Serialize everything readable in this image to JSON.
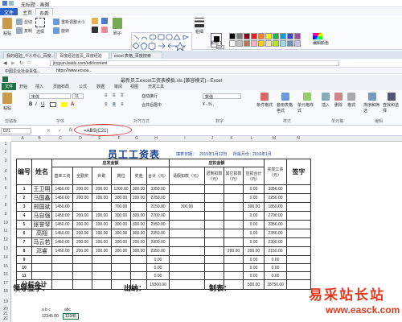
{
  "paint": {
    "title": "无标题 - 画图",
    "tabs": [
      "文件",
      "主页",
      "查看"
    ],
    "color_label": "颜色 1",
    "color2_label": "颜色 2",
    "edit_colors": "编辑颜色",
    "tools": [
      "粘贴",
      "剪切",
      "复制",
      "选择",
      "重新调整大小",
      "旋转",
      "刷子",
      "粗细"
    ],
    "swatch_colors": [
      "#000000",
      "#7f7f7f",
      "#880015",
      "#ed1c24",
      "#ff7f27",
      "#fff200",
      "#22b14c",
      "#00a2e8",
      "#3f48cc",
      "#a349a4",
      "#ffffff",
      "#c3c3c3",
      "#b97a57",
      "#ffaec9",
      "#ffc90e",
      "#efe4b0",
      "#b5e61d",
      "#99d9ea",
      "#7092be",
      "#c8bfe7"
    ]
  },
  "browser": {
    "tabs": [
      "我的经验_个人中心_百度...",
      "百度经验首页_百度经验",
      "excel 表格_百度搜索"
    ],
    "url": "jingyan.baidu.com/edit/content",
    "favorites": [
      "中国企业社会责任...",
      "https://www.ecsoa..."
    ]
  },
  "excel": {
    "title": "最新员工excel工资表模板.xls [兼容模式] - Excel",
    "tabs": [
      "文件",
      "开始",
      "插入",
      "页面布局",
      "公式",
      "数据",
      "审阅",
      "视图",
      "开发工具"
    ],
    "font_name": "宋体",
    "font_size": "11",
    "number_format": "数值",
    "wrap_text": "自动换行",
    "merge": "合并后居中",
    "groups": [
      "剪贴板",
      "字体",
      "对齐方式",
      "数字",
      "样式",
      "单元格",
      "编辑"
    ],
    "ribbon_buttons": [
      "条件格式",
      "套用表格格式",
      "单元格样式",
      "插入",
      "删除",
      "格式",
      "排序和筛选",
      "查找和选择"
    ],
    "name_box": "D21",
    "formula": "=ABS(C21)",
    "columns": [
      "A",
      "B",
      "C",
      "D",
      "E",
      "F",
      "G",
      "H",
      "I",
      "J",
      "K",
      "L",
      "M",
      "N"
    ],
    "rows": [
      "1",
      "2",
      "3",
      "4",
      "5",
      "6",
      "7",
      "8",
      "9",
      "10",
      "11",
      "12",
      "13",
      "14",
      "15",
      "16",
      "17",
      "18",
      "19",
      "20",
      "21",
      "22"
    ]
  },
  "sheet": {
    "title": "员工工资表",
    "date_label": "填表日期：",
    "date_value": "2015年1月12日",
    "period_label": "所属月份：",
    "period_value": "2015年1月",
    "headers": {
      "no": "编号",
      "name": "姓名",
      "payable": "应发金额",
      "deduct": "应扣金额",
      "basic": "基本工资",
      "overtime": "全勤奖",
      "subsidy": "补助",
      "post": "岗位",
      "bonus": "奖金",
      "total": "合计（元）",
      "leave": "请假扣款（元）",
      "late": "迟到扣款（元）",
      "other": "其它扣款（元）",
      "deduct_total": "应扣合计（元）",
      "net": "实发工资（元）",
      "sign": "签字"
    },
    "rows": [
      {
        "no": "1",
        "name": "王卫明",
        "basic": "1450.00",
        "att": "200.00",
        "sub": "200.00",
        "post": "1200.00",
        "bonus": "300.00",
        "total": "3350.00",
        "leave": "",
        "late": "",
        "other": "",
        "dtotal": "0.00",
        "net": "3350.00"
      },
      {
        "no": "2",
        "name": "马国鑫",
        "basic": "1450.00",
        "att": "200.00",
        "sub": "100.00",
        "post": "300.00",
        "bonus": "200.00",
        "total": "2250.00",
        "leave": "",
        "late": "",
        "other": "",
        "dtotal": "0.00",
        "net": "2250.00"
      },
      {
        "no": "3",
        "name": "郑国斌",
        "basic": "1450.00",
        "att": "",
        "sub": "",
        "post": "700.00",
        "bonus": "",
        "total": "2150.00",
        "leave": "300.00",
        "late": "",
        "other": "",
        "dtotal": "300.00",
        "net": "1850.00"
      },
      {
        "no": "4",
        "name": "马自强",
        "basic": "1450.00",
        "att": "200.00",
        "sub": "100.00",
        "post": "300.00",
        "bonus": "300.00",
        "total": "2700.00",
        "leave": "",
        "late": "",
        "other": "",
        "dtotal": "0.00",
        "net": "2700.00"
      },
      {
        "no": "5",
        "name": "张誉琴",
        "basic": "1450.00",
        "att": "200.00",
        "sub": "100.00",
        "post": "300.00",
        "bonus": "300.00",
        "total": "2350.00",
        "leave": "",
        "late": "",
        "other": "",
        "dtotal": "0.00",
        "net": "2350.00"
      },
      {
        "no": "6",
        "name": "高翔",
        "basic": "1450.00",
        "att": "200.00",
        "sub": "100.00",
        "post": "300.00",
        "bonus": "300.00",
        "total": "2350.00",
        "leave": "",
        "late": "",
        "other": "",
        "dtotal": "0.00",
        "net": "2350.00"
      },
      {
        "no": "7",
        "name": "马云若",
        "basic": "1450.00",
        "att": "200.00",
        "sub": "100.00",
        "post": "300.00",
        "bonus": "200.00",
        "total": "2300.00",
        "leave": "",
        "late": "",
        "other": "",
        "dtotal": "0.00",
        "net": "2300.00"
      },
      {
        "no": "8",
        "name": "邓睿",
        "basic": "1450.00",
        "att": "200.00",
        "sub": "100.00",
        "post": "300.00",
        "bonus": "300.00",
        "total": "2350.00",
        "leave": "",
        "late": "",
        "other": "200.00",
        "dtotal": "200.00",
        "net": "2150.00"
      },
      {
        "no": "9",
        "name": "",
        "basic": "",
        "att": "",
        "sub": "",
        "post": "",
        "bonus": "",
        "total": "0.00",
        "leave": "",
        "late": "",
        "other": "",
        "dtotal": "0.00",
        "net": "0.00"
      },
      {
        "no": "10",
        "name": "",
        "basic": "",
        "att": "",
        "sub": "",
        "post": "",
        "bonus": "",
        "total": "0.00",
        "leave": "",
        "late": "",
        "other": "",
        "dtotal": "0.00",
        "net": "0.00"
      },
      {
        "no": "11",
        "name": "",
        "basic": "",
        "att": "",
        "sub": "",
        "post": "",
        "bonus": "",
        "total": "0.00",
        "leave": "",
        "late": "",
        "other": "",
        "dtotal": "0.00",
        "net": "0.00"
      }
    ],
    "subtotal_label": "分栏合计",
    "subtotal_total": "19300.00",
    "subtotal_deduct": "500.00",
    "subtotal_net": "18750.00",
    "leader_sign": "领导签字：",
    "cashier": "出纳：",
    "preparer": "制表：",
    "mini_header": "a b c",
    "mini_header2": "abc",
    "mini_val": "12345.00",
    "mini_val2": "12345"
  },
  "watermark": {
    "text": "易采站长站",
    "url": "www.easck.com"
  }
}
